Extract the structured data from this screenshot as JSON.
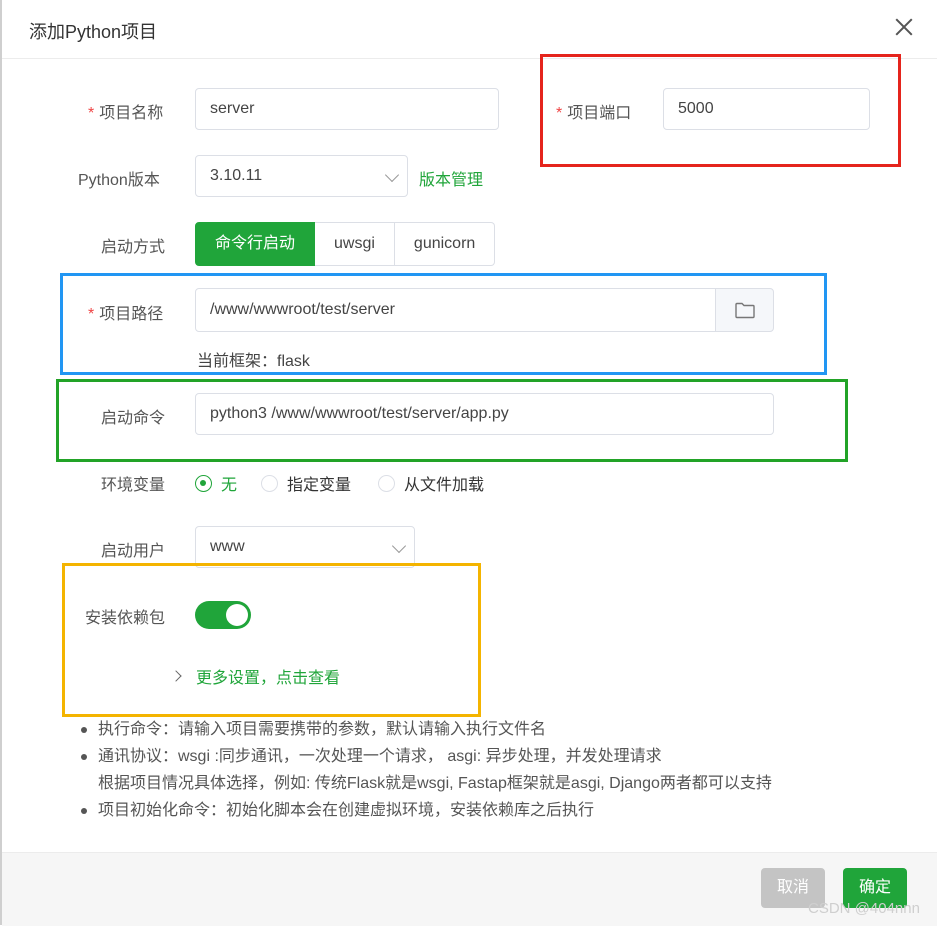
{
  "dialog": {
    "title": "添加Python项目"
  },
  "form": {
    "project_name": {
      "required_mark": "*",
      "label": "项目名称",
      "value": "server"
    },
    "project_port": {
      "required_mark": "*",
      "label": "项目端口",
      "value": "5000"
    },
    "python_version": {
      "label": "Python版本",
      "value": "3.10.11",
      "manage_link": "版本管理"
    },
    "start_mode": {
      "label": "启动方式",
      "options": [
        "命令行启动",
        "uwsgi",
        "gunicorn"
      ],
      "selected": "命令行启动"
    },
    "project_path": {
      "required_mark": "*",
      "label": "项目路径",
      "value": "/www/wwwroot/test/server",
      "framework_hint": "当前框架：flask",
      "folder_icon": "folder-icon"
    },
    "start_command": {
      "label": "启动命令",
      "value": "python3 /www/wwwroot/test/server/app.py"
    },
    "env_vars": {
      "label": "环境变量",
      "options": [
        "无",
        "指定变量",
        "从文件加载"
      ],
      "selected": "无"
    },
    "run_user": {
      "label": "启动用户",
      "value": "www"
    },
    "install_deps": {
      "label": "安装依赖包",
      "enabled": true
    },
    "more_settings": "更多设置，点击查看"
  },
  "tips": {
    "line1": "执行命令：请输入项目需要携带的参数，默认请输入执行文件名",
    "line2a": "通讯协议：wsgi :同步通讯，一次处理一个请求， asgi: 异步处理，并发处理请求",
    "line2b": "根据项目情况具体选择，例如: 传统Flask就是wsgi, Fastap框架就是asgi, Django两者都可以支持",
    "line3": "项目初始化命令：初始化脚本会在创建虚拟环境，安装依赖库之后执行"
  },
  "footer": {
    "cancel_label": "取消",
    "ok_label": "确定"
  },
  "watermark": "CSDN @404nnn",
  "colors": {
    "accent": "#20a53a",
    "required": "#ef4444",
    "highlight_red": "#e5241c",
    "highlight_blue": "#2196f3",
    "highlight_green": "#22a327",
    "highlight_yellow": "#f4b400"
  }
}
